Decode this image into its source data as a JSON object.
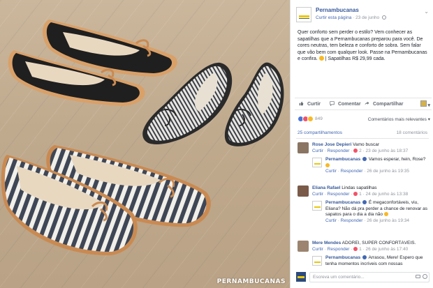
{
  "photo": {
    "watermark": "PERNAMBUCANAS"
  },
  "post": {
    "page_name": "Pernambucanas",
    "follow_label": "Curtir esta página",
    "date": "23 de junho",
    "text": "Quer conforto sem perder o estilo? Vem conhecer as sapatilhas que a Pernambucanas preparou para você. De cores neutras, tem beleza e conforto de sobra. Sem falar que vão bem com qualquer look. Passe na Pernambucanas e confira.",
    "text_tail": "| Sapatilhas R$ 29,99 cada."
  },
  "actions": {
    "like": "Curtir",
    "comment": "Comentar",
    "share": "Compartilhar"
  },
  "reactions": {
    "count": "849",
    "sort_label": "Comentários mais relevantes ▾"
  },
  "stats": {
    "shares": "25 compartilhamentos",
    "comments": "18 comentários"
  },
  "comments": [
    {
      "name": "Rose Jose Depieri",
      "text": "Vamo buscar",
      "like": "Curtir",
      "reply": "Responder",
      "likes": "2",
      "date": "23 de junho às 18:37",
      "reply_item": {
        "name": "Pernambucanas",
        "text": "Vamos esperar, hein, Rose?",
        "like": "Curtir",
        "reply": "Responder",
        "date": "26 de junho às 19:35"
      }
    },
    {
      "name": "Eliana Rafael",
      "text": "Lindas sapatilhas",
      "like": "Curtir",
      "reply": "Responder",
      "likes": "1",
      "date": "24 de junho às 13:38",
      "reply_item": {
        "name": "Pernambucanas",
        "text": "É megaconfortáveis, viu, Eliana? Não dá pra perder a chance de renovar as sapatos para o dia a dia não",
        "like": "Curtir",
        "reply": "Responder",
        "date": "26 de junho às 19:34"
      }
    },
    {
      "name": "Mere Mendes",
      "text": "ADOREI, SUPER CONFORTÁVEIS.",
      "like": "Curtir",
      "reply": "Responder",
      "likes": "1",
      "date": "26 de junho às 17:40",
      "reply_item": {
        "name": "Pernambucanas",
        "text": "Arrasou, Mere! Espero que tenha momentos incríveis com nossas",
        "like": "",
        "reply": "",
        "date": ""
      }
    }
  ],
  "composer": {
    "placeholder": "Escreva um comentário..."
  },
  "colors": {
    "link": "#365899",
    "brand_yellow": "#e9c80b",
    "meta_gray": "#90949c"
  }
}
